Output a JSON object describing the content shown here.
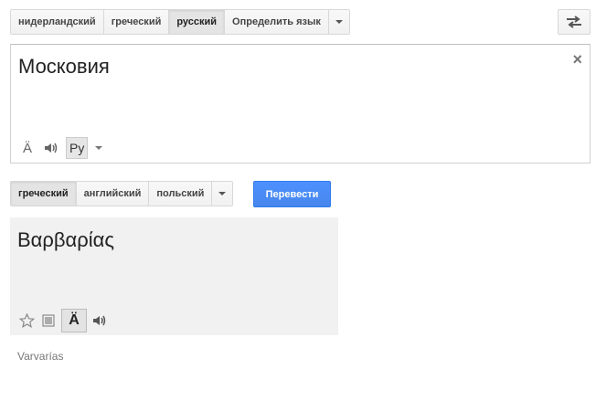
{
  "source_languages": {
    "items": [
      {
        "label": "нидерландский",
        "active": false
      },
      {
        "label": "греческий",
        "active": false
      },
      {
        "label": "русский",
        "active": true
      },
      {
        "label": "Определить язык",
        "active": false
      }
    ]
  },
  "source": {
    "text": "Московия",
    "clear_glyph": "×",
    "translit_glyph": "Ä",
    "ime_label": "Ру"
  },
  "target_languages": {
    "items": [
      {
        "label": "греческий",
        "active": true
      },
      {
        "label": "английский",
        "active": false
      },
      {
        "label": "польский",
        "active": false
      }
    ]
  },
  "translate_button": "Перевести",
  "result": {
    "text": "Βαρβαρίας",
    "translit_glyph": "Ä",
    "transliteration": "Varvarías"
  },
  "icons": [
    "swap-icon",
    "clear-icon",
    "transliterate-icon",
    "speaker-icon",
    "star-icon",
    "list-icon"
  ]
}
